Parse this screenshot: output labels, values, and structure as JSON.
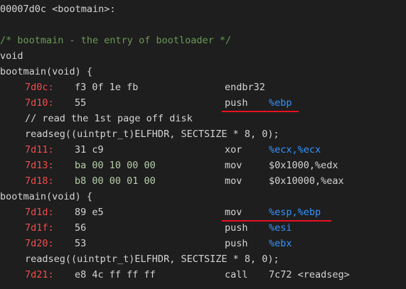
{
  "header": "00007d0c <bootmain>:",
  "comment": "/* bootmain - the entry of bootloader */",
  "ret_type": "void",
  "func_sig_1": "bootmain(void) {",
  "func_sig_2": "bootmain(void) {",
  "asm_lines": [
    {
      "addr": "7d0c:",
      "bytes": "f3 0f 1e fb",
      "mnemonic": "endbr32",
      "operands": ""
    },
    {
      "addr": "7d10:",
      "bytes": "55",
      "mnemonic": "push",
      "operands": "%ebp"
    },
    {
      "addr": "7d11:",
      "bytes": "31 c9",
      "mnemonic": "xor",
      "operands": "%ecx,%ecx"
    },
    {
      "addr": "7d13:",
      "bytes": "ba 00 10 00 00",
      "mnemonic": "mov",
      "operands": "$0x1000,%edx"
    },
    {
      "addr": "7d18:",
      "bytes": "b8 00 00 01 00",
      "mnemonic": "mov",
      "operands": "$0x10000,%eax"
    },
    {
      "addr": "7d1d:",
      "bytes": "89 e5",
      "mnemonic": "mov",
      "operands": "%esp,%ebp"
    },
    {
      "addr": "7d1f:",
      "bytes": "56",
      "mnemonic": "push",
      "operands": "%esi"
    },
    {
      "addr": "7d20:",
      "bytes": "53",
      "mnemonic": "push",
      "operands": "%ebx"
    },
    {
      "addr": "7d21:",
      "bytes": "e8 4c ff ff ff",
      "mnemonic": "call",
      "operands": "7c72 <readseg>"
    }
  ],
  "src_comment": "// read the 1st page off disk",
  "src_call_1": "readseg((uintptr_t)ELFHDR, SECTSIZE * 8, 0);",
  "src_call_2": "readseg((uintptr_t)ELFHDR, SECTSIZE * 8, 0);",
  "colors": {
    "background": "#1e1e1e",
    "text": "#d4d4d4",
    "address": "#f14c4c",
    "register": "#3794ff",
    "comment": "#6a9955",
    "highlight_underline": "#e81123"
  }
}
